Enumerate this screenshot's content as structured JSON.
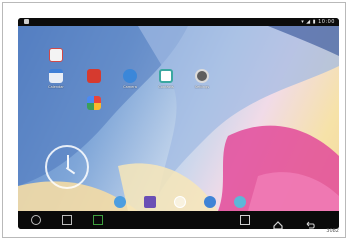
{
  "status_bar": {
    "right_text": "▾ ◢ ▮ 10:00"
  },
  "apps": [
    {
      "label": "",
      "name": "browser-app"
    },
    {
      "label": "Calendar",
      "name": "calendar-app"
    },
    {
      "label": "",
      "name": "gallery-app"
    },
    {
      "label": "Camera",
      "name": "camera-app"
    },
    {
      "label": "Contacts",
      "name": "contacts-app"
    },
    {
      "label": "Settings",
      "name": "settings-app"
    },
    {
      "label": "",
      "name": "photos-app"
    }
  ],
  "figure_code": "3082",
  "colors": {
    "nav_bar": "#0a0a0a",
    "wallpaper_accent": "#e24a9a"
  }
}
